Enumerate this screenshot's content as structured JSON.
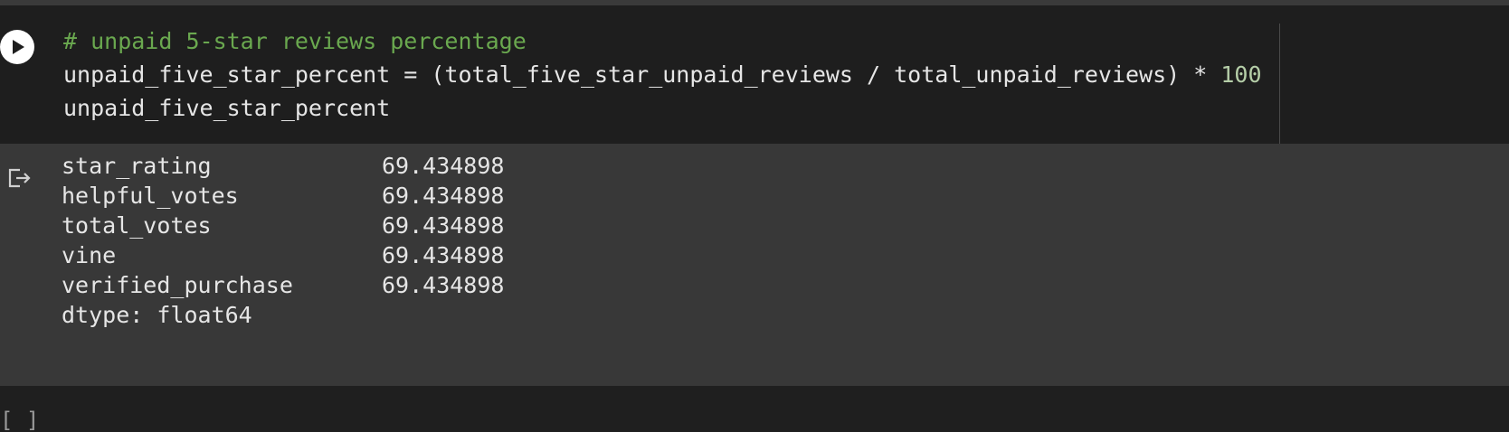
{
  "code_cell": {
    "lines": [
      {
        "comment": "# unpaid 5-star reviews percentage"
      },
      {
        "code": "unpaid_five_star_percent = (total_five_star_unpaid_reviews / total_unpaid_reviews) * ",
        "number": "100"
      },
      {
        "code": "unpaid_five_star_percent"
      }
    ]
  },
  "output": {
    "rows": [
      {
        "label": "star_rating",
        "value": "69.434898"
      },
      {
        "label": "helpful_votes",
        "value": "69.434898"
      },
      {
        "label": "total_votes",
        "value": "69.434898"
      },
      {
        "label": "vine",
        "value": "69.434898"
      },
      {
        "label": "verified_purchase",
        "value": "69.434898"
      }
    ],
    "dtype": "dtype: float64"
  },
  "next_cell": {
    "bracket": "[ ]"
  },
  "colors": {
    "background": "#1e1e1e",
    "output_background": "#383838",
    "comment": "#6aa84f",
    "number": "#b5cea8",
    "text": "#e6e6e6"
  },
  "icons": {
    "run": "play-icon",
    "output": "output-redirect-icon"
  }
}
